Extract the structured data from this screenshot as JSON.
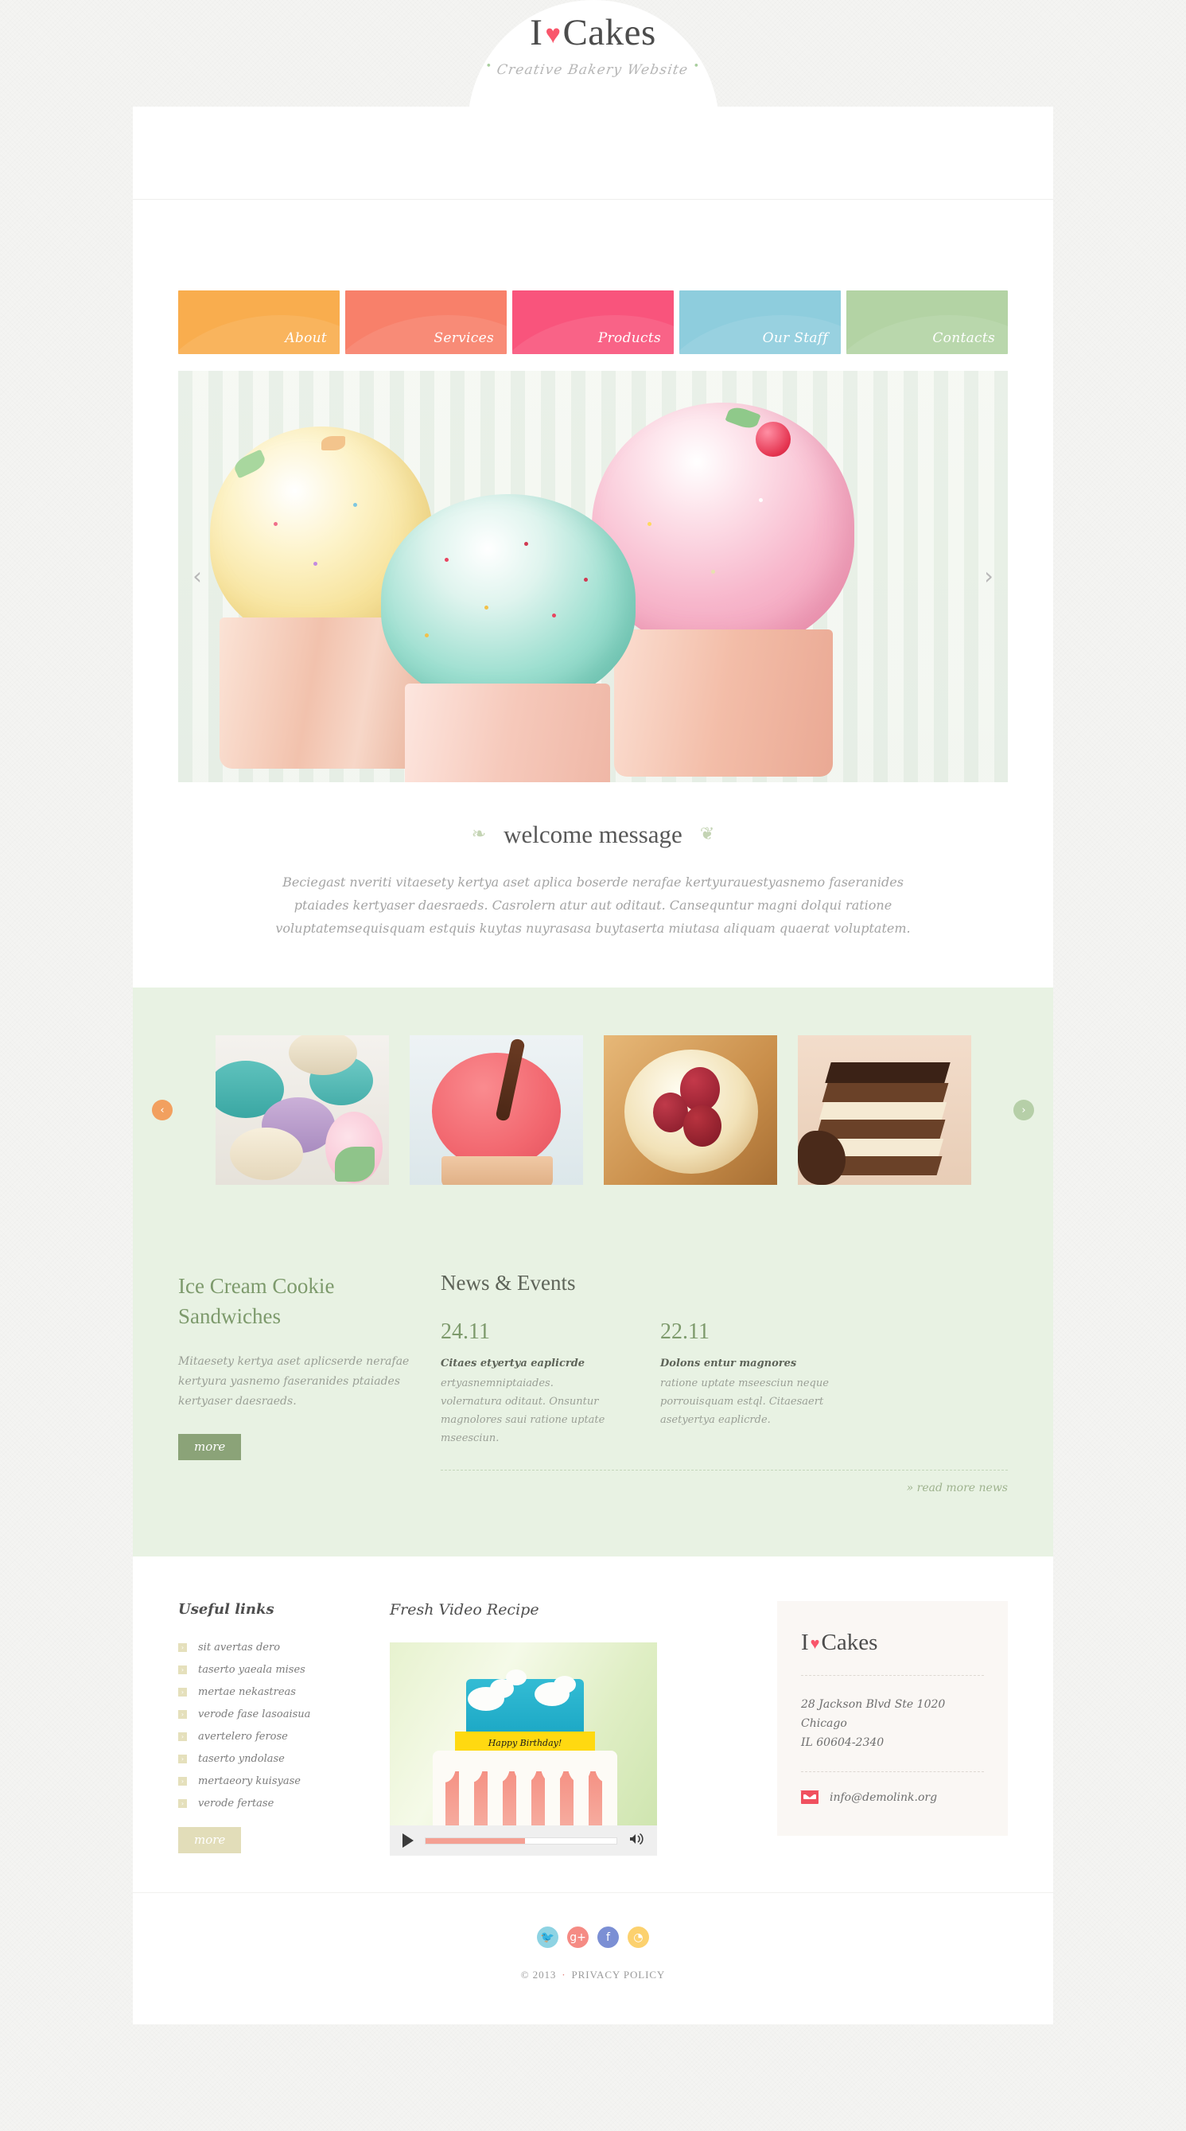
{
  "brand": {
    "name_before": "I",
    "heart": "♥",
    "name_after": "Cakes",
    "tagline": "Creative Bakery Website",
    "dot": "•"
  },
  "nav": {
    "items": [
      {
        "label": "About",
        "color": "#f9ad4e"
      },
      {
        "label": "Services",
        "color": "#f8806a"
      },
      {
        "label": "Products",
        "color": "#f9547c"
      },
      {
        "label": "Our Staff",
        "color": "#8ecddd"
      },
      {
        "label": "Contacts",
        "color": "#b3d3a4"
      }
    ]
  },
  "slider": {
    "prev_icon": "‹",
    "next_icon": "›",
    "alt": "three cupcakes yellow mint pink"
  },
  "welcome": {
    "flourish_left": "❧",
    "title": "welcome message",
    "flourish_right": "❦",
    "text": "Beciegast nveriti vitaesety kertya aset aplica boserde nerafae kertyurauestyasnemo faseranides ptaiades kertyaser daesraeds. Casrolern atur aut oditaut. Cansequntur magni dolqui ratione voluptatemsequisquam estquis kuytas nuyrasasa buytaserta miutasa aliquam quaerat voluptatem."
  },
  "gallery": {
    "prev_icon": "‹",
    "next_icon": "›",
    "items": [
      {
        "alt": "colorful macarons with flower"
      },
      {
        "alt": "pink frosted cupcake with chocolate stick"
      },
      {
        "alt": "cherry dessert with cocoa dusting"
      },
      {
        "alt": "chocolate layer cake slice"
      }
    ]
  },
  "promo": {
    "title": "Ice Cream Cookie Sandwiches",
    "text": "Mitaesety kertya aset aplicserde nerafae kertyura yasnemo faseranides ptaiades kertyaser daesraeds.",
    "button": "more"
  },
  "news": {
    "title": "News & Events",
    "items": [
      {
        "date": "24.11",
        "headline": "Citaes etyertya eaplicrde",
        "body": "ertyasnemniptaiades. volernatura oditaut. Onsuntur magnolores saui ratione uptate mseesciun."
      },
      {
        "date": "22.11",
        "headline": "Dolons entur magnores",
        "body": "ratione uptate mseesciun neque porrouisquam estql. Citaesaert asetyertya eaplicrde."
      }
    ],
    "read_more": "»  read more news"
  },
  "footer": {
    "links_title": "Useful links",
    "link_bullet": "›",
    "links": [
      "sit avertas dero",
      "taserto yaeala mises",
      "mertae nekastreas",
      "verode fase lasoaisua",
      "avertelero ferose",
      "taserto yndolase",
      "mertaeory kuisyase",
      "verode fertase"
    ],
    "links_button": "more",
    "video_title": "Fresh Video Recipe",
    "video": {
      "banner_text": "Happy Birthday!",
      "progress_percent": 52,
      "play_label": "play",
      "volume_label": "volume"
    },
    "card": {
      "logo_before": "I",
      "logo_heart": "♥",
      "logo_after": "Cakes",
      "address_lines": [
        "28 Jackson Blvd Ste 1020",
        "Chicago",
        "IL 60604-2340"
      ],
      "email": "info@demolink.org"
    }
  },
  "bottom": {
    "socials": [
      {
        "name": "twitter",
        "glyph": "🐦",
        "color": "#8ed3e3"
      },
      {
        "name": "google-plus",
        "glyph": "g+",
        "color": "#f58b84"
      },
      {
        "name": "facebook",
        "glyph": "f",
        "color": "#7b8fd4"
      },
      {
        "name": "rss",
        "glyph": "◔",
        "color": "#fcd16e"
      }
    ],
    "copyright": "© 2013",
    "separator": "·",
    "privacy": "PRIVACY POLICY"
  },
  "colors": {
    "heart": "#f9566b",
    "green_heading": "#7d9a6c",
    "panel_green": "#e8f2e3",
    "accent_orange": "#f2a05f"
  }
}
